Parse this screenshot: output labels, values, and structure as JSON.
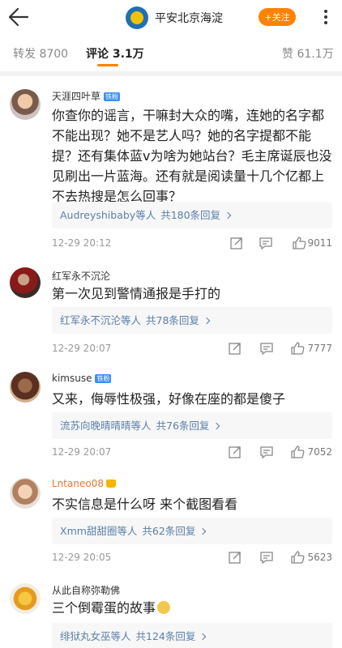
{
  "header": {
    "account_name": "平安北京海淀",
    "follow_label": "+关注"
  },
  "tabs": [
    {
      "label": "转发",
      "count": "8700"
    },
    {
      "label": "评论",
      "count": "3.1万"
    },
    {
      "label": "赞",
      "count": "61.1万"
    }
  ],
  "comments": [
    {
      "name": "天涯四叶草",
      "badge": "铁粉",
      "text": "你查你的谣言，干嘛封大众的嘴，连她的名字都不能出现？她不是艺人吗？她的名字提都不能提？还有集体蓝v为啥为她站台？毛主席诞辰也没见刷出一片蓝海。还有就是阅读量十几个亿都上不去热搜是怎么回事？",
      "reply_user": "Audreyshibaby",
      "reply_mid": "等人",
      "reply_count": "共180条回复",
      "time": "12-29 20:12",
      "likes": "9011"
    },
    {
      "name": "红军永不沉沦",
      "badge": "",
      "text": "第一次见到警情通报是手打的",
      "reply_user": "红军永不沉沦",
      "reply_mid": "等人",
      "reply_count": "共78条回复",
      "time": "12-29 20:07",
      "likes": "7777"
    },
    {
      "name": "kimsuse",
      "badge": "铁粉",
      "text": "又来，侮辱性极强，好像在座的都是傻子",
      "reply_user": "流苏向晚晴晴晴",
      "reply_mid": "等人",
      "reply_count": "共76条回复",
      "time": "12-29 20:07",
      "likes": "7052"
    },
    {
      "name": "Lntaneo08",
      "badge": "",
      "text": "不实信息是什么呀 来个截图看看",
      "reply_user": "Xmm甜甜圈",
      "reply_mid": "等人",
      "reply_count": "共62条回复",
      "time": "12-29 20:05",
      "likes": "5623"
    },
    {
      "name": "从此自称弥勒佛",
      "badge": "",
      "text": "三个倒霉蛋的故事",
      "reply_user": "绯狱丸女巫",
      "reply_mid": "等人",
      "reply_count": "共124条回复",
      "time": "",
      "likes": ""
    }
  ],
  "colors": {
    "accent": "#ff8200",
    "link": "#5a7fa8",
    "verified": "#2e8ae6"
  }
}
